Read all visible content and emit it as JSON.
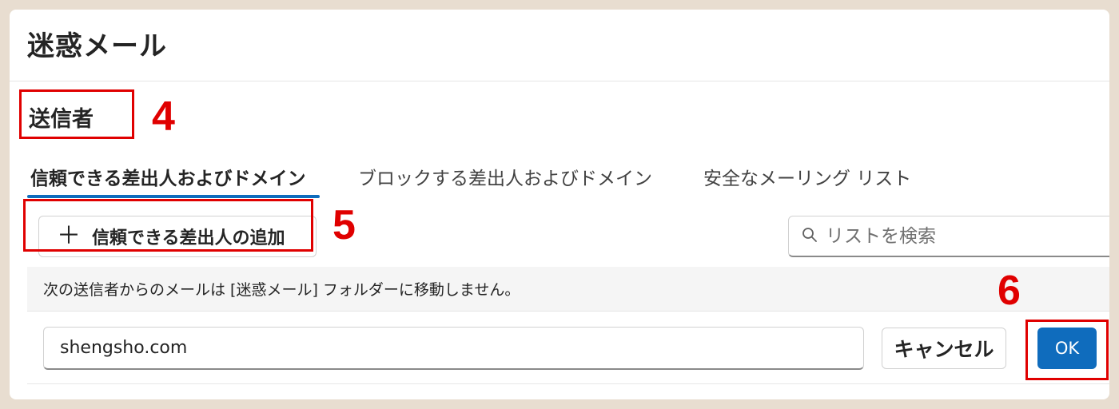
{
  "dialog": {
    "title": "迷惑メール"
  },
  "section": {
    "label": "送信者"
  },
  "tabs": [
    {
      "label": "信頼できる差出人およびドメイン",
      "active": true
    },
    {
      "label": "ブロックする差出人およびドメイン",
      "active": false
    },
    {
      "label": "安全なメーリング リスト",
      "active": false
    }
  ],
  "toolbar": {
    "add_label": "信頼できる差出人の追加",
    "add_icon": "plus-icon",
    "search_placeholder": "リストを検索",
    "search_icon": "search-icon"
  },
  "notice": {
    "text": "次の送信者からのメールは [迷惑メール] フォルダーに移動しません。"
  },
  "entry": {
    "value": "shengsho.com",
    "cancel_label": "キャンセル",
    "ok_label": "OK"
  },
  "annotations": {
    "n4": "4",
    "n5": "5",
    "n6": "6"
  },
  "colors": {
    "accent": "#0f6cbd",
    "annotation": "#e00000"
  }
}
